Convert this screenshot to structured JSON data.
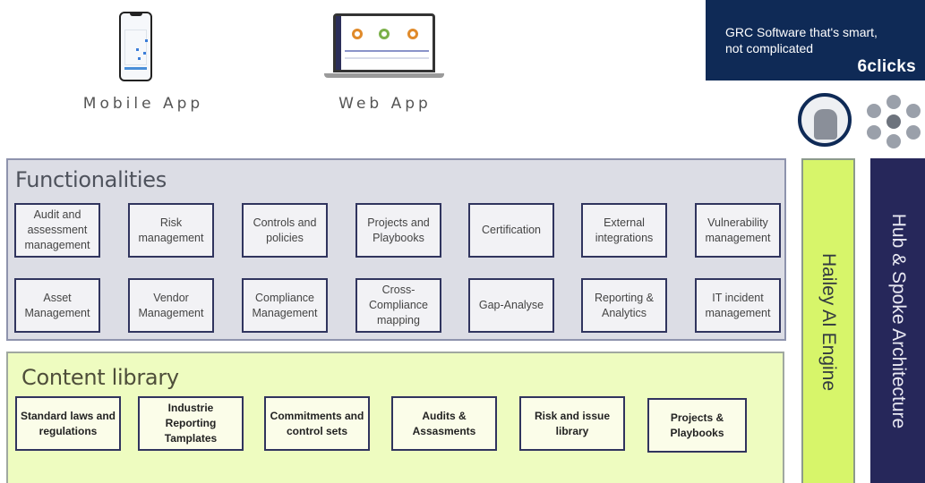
{
  "apps": {
    "mobile_label": "Mobile App",
    "web_label": "Web App"
  },
  "brand": {
    "tagline_line1": "GRC Software that's smart,",
    "tagline_line2": "not complicated",
    "logo": "6clicks",
    "bg_color": "#0f2a56"
  },
  "functionalities": {
    "title": "Functionalities",
    "items": [
      "Audit and assessment management",
      "Risk management",
      "Controls and policies",
      "Projects and Playbooks",
      "Certification",
      "External integrations",
      "Vulnerability management",
      "Asset Management",
      "Vendor Management",
      "Compliance Management",
      "Cross-Compliance mapping",
      "Gap-Analyse",
      "Reporting & Analytics",
      "IT incident management"
    ]
  },
  "content_library": {
    "title": "Content library",
    "items": [
      "Standard laws and regulations",
      "Industrie Reporting Tamplates",
      "Commitments and control sets",
      "Audits & Assasments",
      "Risk and issue library",
      "Projects & Playbooks"
    ]
  },
  "side": {
    "hailey": "Hailey AI Engine",
    "hub": "Hub & Spoke Architecture",
    "hailey_color": "#d7f56a",
    "hub_color": "#26275a"
  },
  "icons": [
    "mobile-phone-icon",
    "laptop-icon",
    "ai-robot-icon",
    "hub-spoke-cluster-icon"
  ]
}
